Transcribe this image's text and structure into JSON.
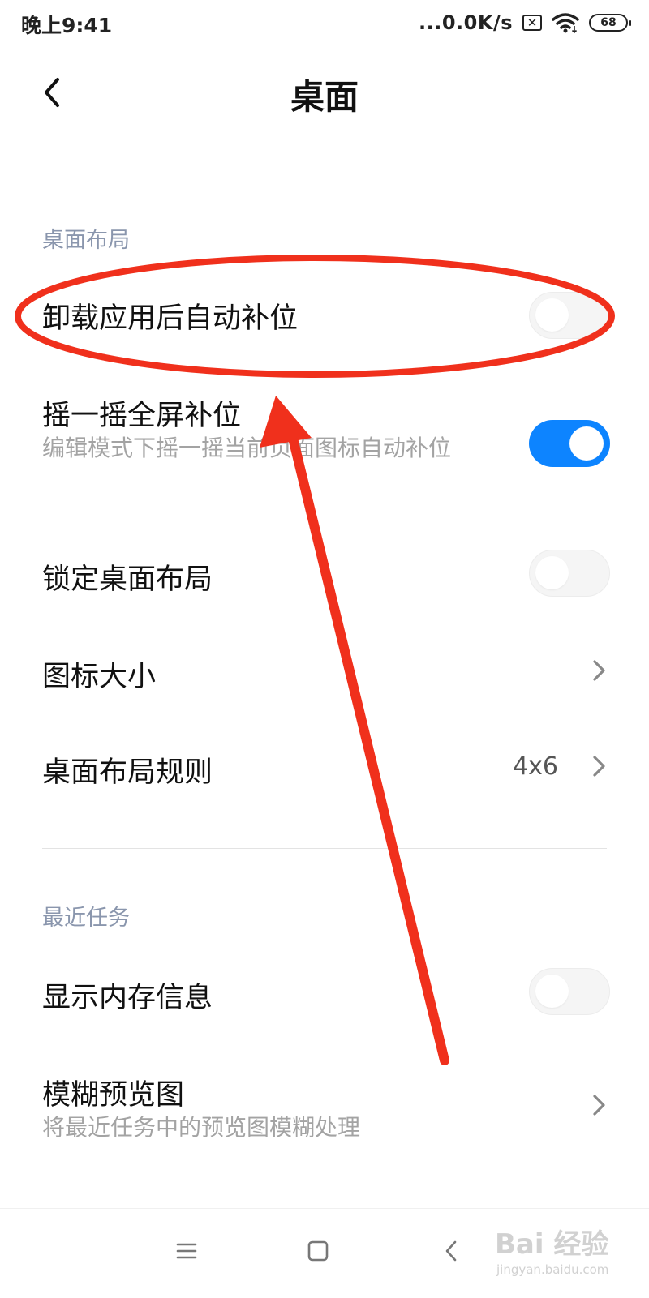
{
  "status_bar": {
    "time": "晚上9:41",
    "net_speed": "...0.0K/s",
    "sim_icon": "sim-x-icon",
    "sim_glyph": "✕",
    "wifi_icon": "wifi-icon",
    "battery_level": "68"
  },
  "header": {
    "back_icon": "back-arrow-icon",
    "title": "桌面"
  },
  "sections": [
    {
      "header": "桌面布局",
      "items": [
        {
          "title": "卸载应用后自动补位",
          "control": "toggle",
          "state": "off"
        },
        {
          "title": "摇一摇全屏补位",
          "subtitle": "编辑模式下摇一摇当前页面图标自动补位",
          "control": "toggle",
          "state": "on"
        },
        {
          "title": "锁定桌面布局",
          "control": "toggle",
          "state": "off"
        },
        {
          "title": "图标大小",
          "control": "chevron"
        },
        {
          "title": "桌面布局规则",
          "value": "4x6",
          "control": "chevron"
        }
      ]
    },
    {
      "header": "最近任务",
      "items": [
        {
          "title": "显示内存信息",
          "control": "toggle",
          "state": "off"
        },
        {
          "title": "模糊预览图",
          "subtitle": "将最近任务中的预览图模糊处理",
          "control": "chevron"
        }
      ]
    }
  ],
  "nav_bar": {
    "menu_icon": "menu-icon",
    "home_icon": "home-square-icon",
    "back_icon": "back-triangle-icon"
  },
  "colors": {
    "accent": "#0d84ff",
    "section_header": "#8a96ad",
    "annotation": "#f0301c"
  },
  "watermark": {
    "main": "Bai 经验",
    "sub": "jingyan.baidu.com"
  }
}
